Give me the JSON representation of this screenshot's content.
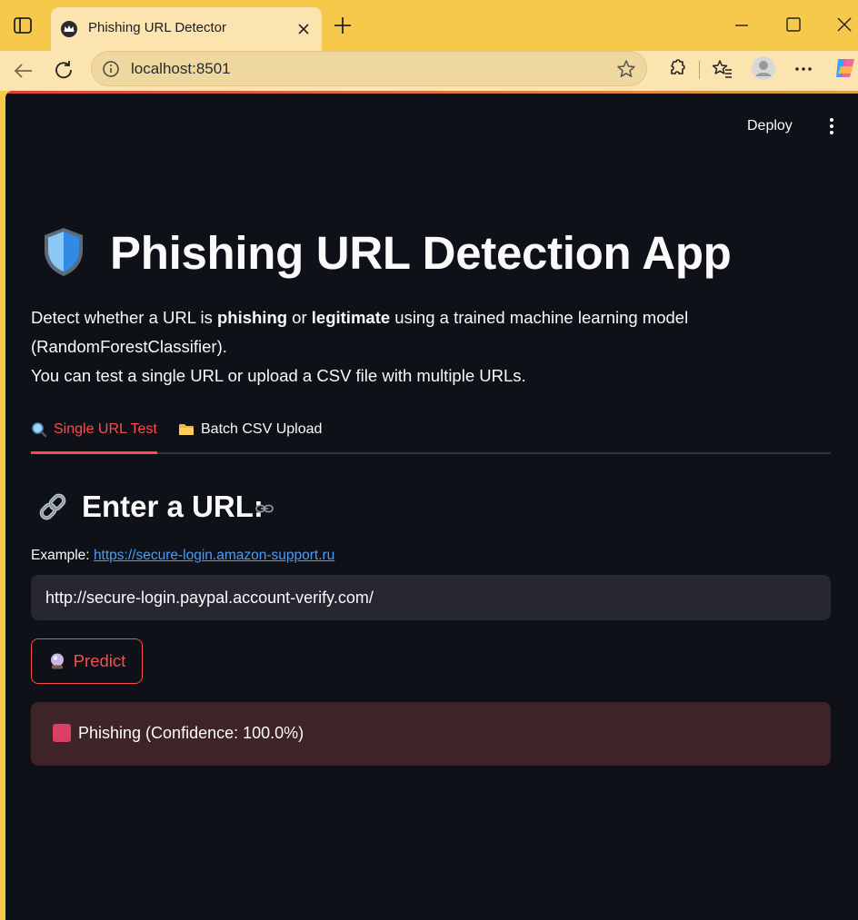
{
  "browser": {
    "tab_title": "Phishing URL Detector",
    "url": "localhost:8501"
  },
  "header": {
    "deploy_label": "Deploy"
  },
  "main": {
    "title": "Phishing URL Detection App",
    "desc_part1": "Detect whether a URL is ",
    "desc_bold1": "phishing",
    "desc_part2": " or ",
    "desc_bold2": "legitimate",
    "desc_part3": " using a trained machine learning model (RandomForestClassifier).",
    "desc_line2": "You can test a single URL or upload a CSV file with multiple URLs.",
    "tabs": [
      {
        "label": "Single URL Test",
        "icon": "magnifier-icon"
      },
      {
        "label": "Batch CSV Upload",
        "icon": "folder-icon"
      }
    ],
    "section_heading": "Enter a URL:",
    "example_label": "Example:",
    "example_link": "https://secure-login.amazon-support.ru",
    "url_input_value": "http://secure-login.paypal.account-verify.com/",
    "predict_label": "Predict",
    "result_text": "Phishing (Confidence: 100.0%)"
  },
  "colors": {
    "app_bg": "#0e1117",
    "accent": "#ff4b4b",
    "alert_bg": "#3e2328",
    "link": "#4a9df8",
    "browser_frame": "#f6c94a"
  }
}
